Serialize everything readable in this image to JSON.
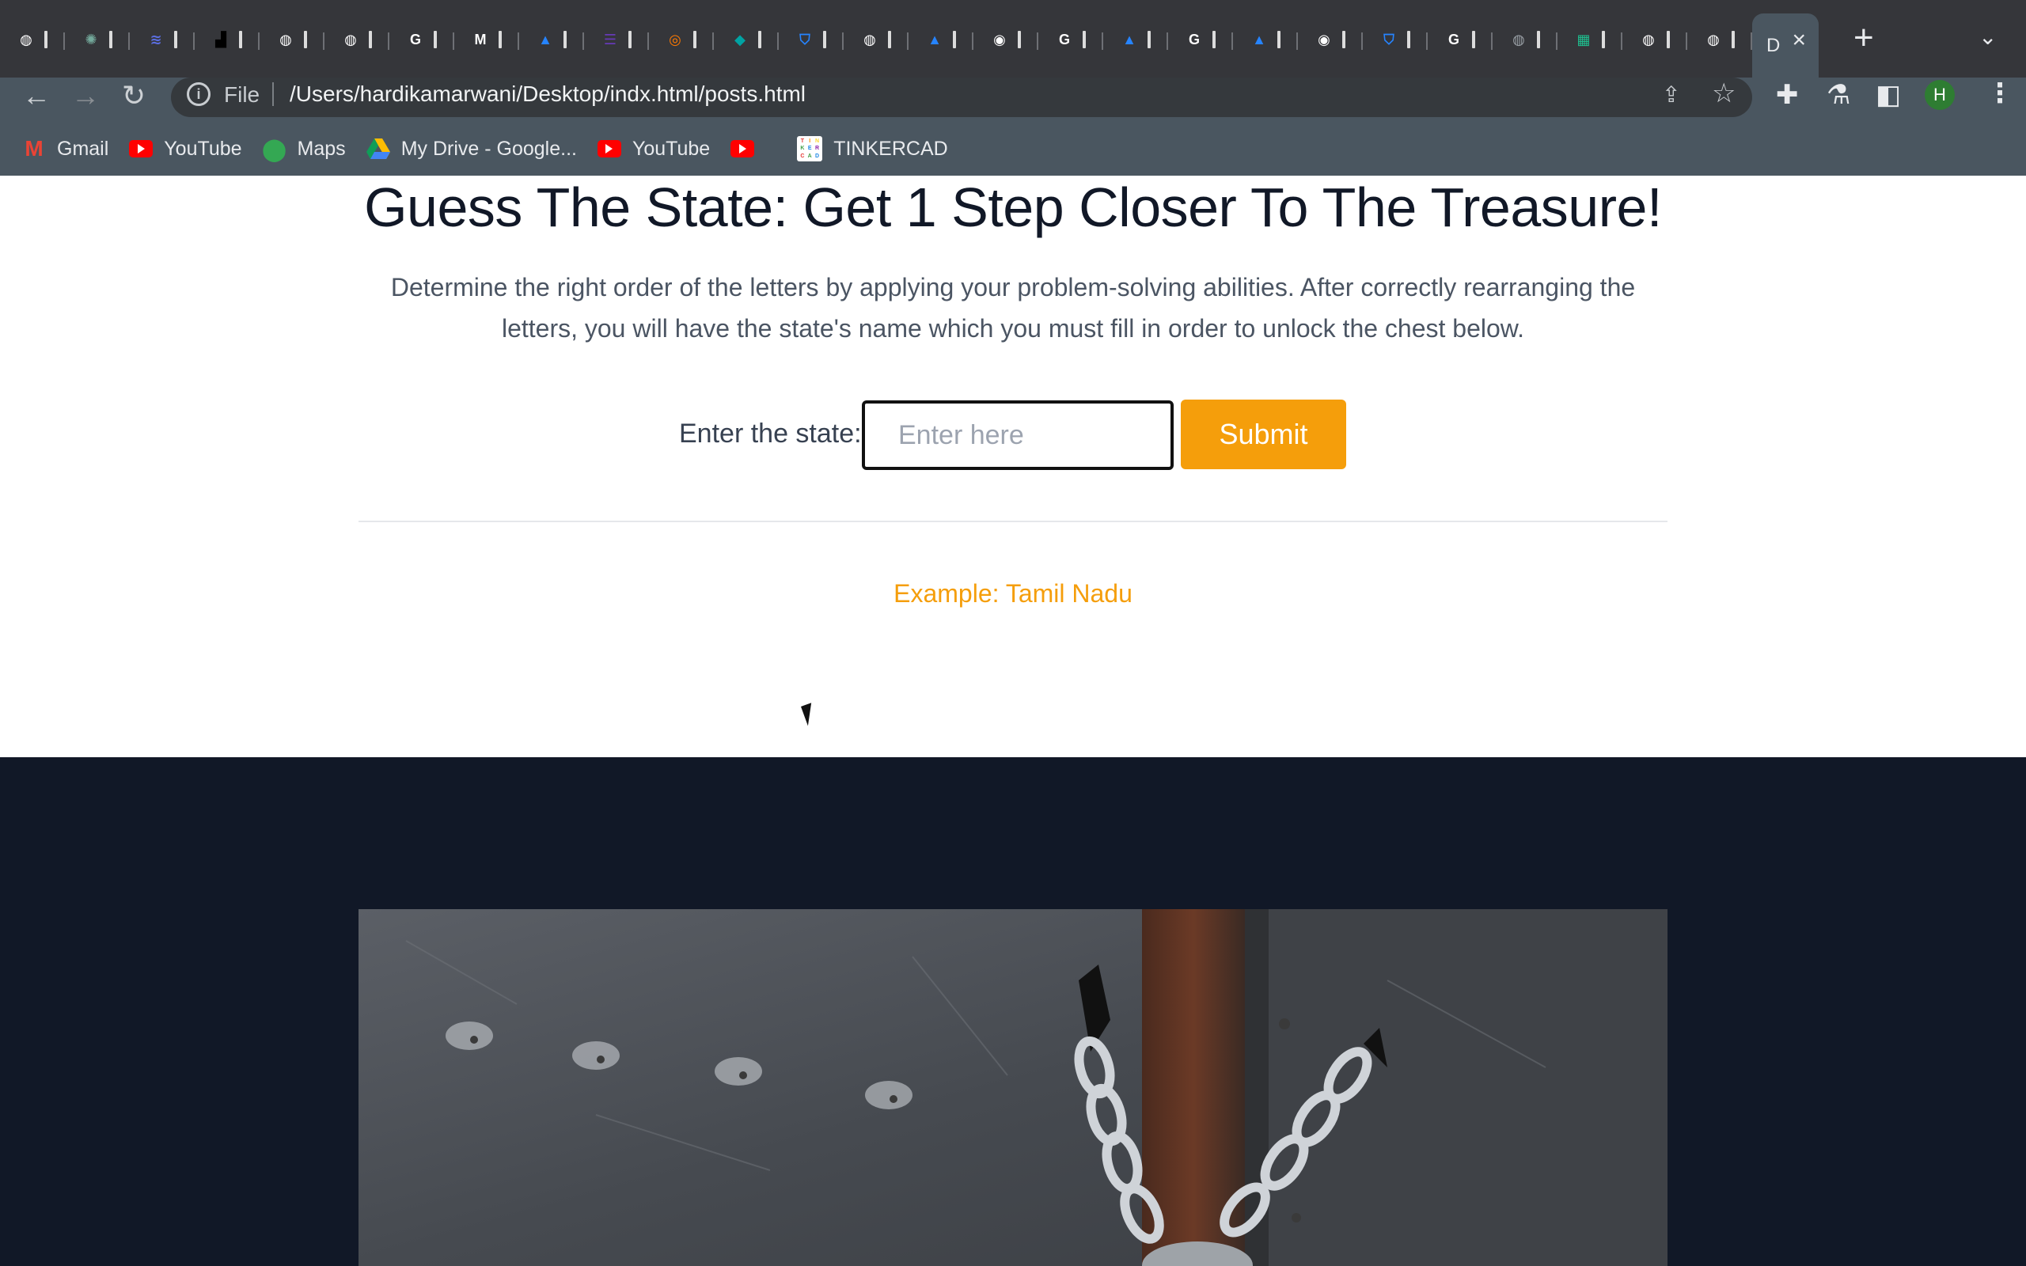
{
  "browser": {
    "tabs": [
      {
        "icon": "globe-icon",
        "color": "#ffffff"
      },
      {
        "icon": "chatgpt-icon",
        "color": "#74aa9c"
      },
      {
        "icon": "stack-icon",
        "color": "#5b6ee1"
      },
      {
        "icon": "unsplash-icon",
        "color": "#000000"
      },
      {
        "icon": "globe-icon",
        "color": "#ffffff"
      },
      {
        "icon": "globe-icon",
        "color": "#ffffff"
      },
      {
        "icon": "google-icon",
        "color": "#ffffff"
      },
      {
        "icon": "gmail-icon",
        "color": "#ffffff"
      },
      {
        "icon": "atlassian-icon",
        "color": "#2684ff"
      },
      {
        "icon": "forms-icon",
        "color": "#673ab7"
      },
      {
        "icon": "orbit-icon",
        "color": "#ff7a00"
      },
      {
        "icon": "diamond-icon",
        "color": "#00a3a3"
      },
      {
        "icon": "bitbucket-icon",
        "color": "#2684ff"
      },
      {
        "icon": "globe-icon",
        "color": "#ffffff"
      },
      {
        "icon": "atlassian-icon",
        "color": "#2684ff"
      },
      {
        "icon": "chrome-icon",
        "color": "#ffffff"
      },
      {
        "icon": "google-icon",
        "color": "#ffffff"
      },
      {
        "icon": "atlassian-icon",
        "color": "#2684ff"
      },
      {
        "icon": "google-icon",
        "color": "#ffffff"
      },
      {
        "icon": "atlassian-icon",
        "color": "#2684ff"
      },
      {
        "icon": "chrome-icon",
        "color": "#ffffff"
      },
      {
        "icon": "bitbucket-icon",
        "color": "#2684ff"
      },
      {
        "icon": "google-icon",
        "color": "#ffffff"
      },
      {
        "icon": "globe-icon",
        "color": "#9aa0a6"
      },
      {
        "icon": "sheets-icon",
        "color": "#1fbf8f"
      },
      {
        "icon": "globe-icon",
        "color": "#ffffff"
      },
      {
        "icon": "globe-icon",
        "color": "#ffffff"
      }
    ],
    "active_tab_label": "D",
    "url_scheme": "File",
    "url": "/Users/hardikamarwani/Desktop/indx.html/posts.html",
    "profile_initial": "H",
    "bookmarks": [
      {
        "label": "Gmail",
        "icon": "gmail-icon"
      },
      {
        "label": "YouTube",
        "icon": "youtube-icon"
      },
      {
        "label": "Maps",
        "icon": "maps-icon"
      },
      {
        "label": "My Drive - Google...",
        "icon": "drive-icon"
      },
      {
        "label": "YouTube",
        "icon": "youtube-icon"
      },
      {
        "label": "",
        "icon": "youtube-icon"
      },
      {
        "label": "TINKERCAD",
        "icon": "tinkercad-icon"
      }
    ]
  },
  "page": {
    "headline": "Guess The State: Get 1 Step Closer To The Treasure!",
    "description": "Determine the right order of the letters by applying your problem-solving abilities. After correctly rearranging the letters, you will have the state's name which you must fill in order to unlock the chest below.",
    "form": {
      "label": "Enter the state:",
      "input_value": "",
      "input_placeholder": "Enter here",
      "submit_label": "Submit"
    },
    "example": "Example: Tamil Nadu",
    "accent_color": "#f59e0b",
    "dark_bg": "#111827"
  }
}
